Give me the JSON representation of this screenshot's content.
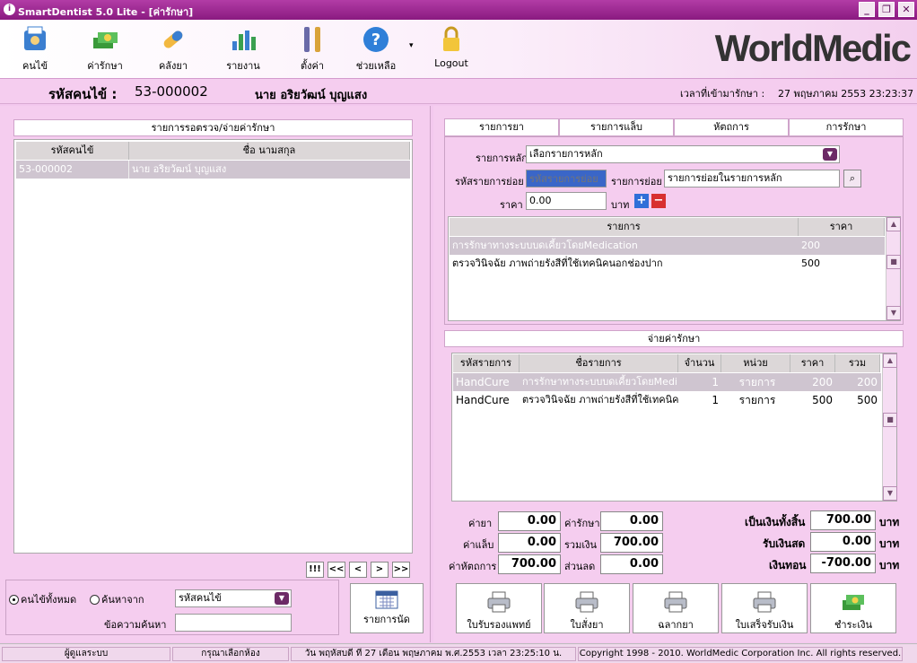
{
  "window": {
    "title": "SmartDentist 5.0 Lite - [ค่ารักษา]",
    "min": "_",
    "restore": "❐",
    "close": "✕"
  },
  "toolbar": {
    "items": [
      {
        "label": "คนไข้",
        "icon": "patient-icon"
      },
      {
        "label": "ค่ารักษา",
        "icon": "money-icon"
      },
      {
        "label": "คลังยา",
        "icon": "pill-icon"
      },
      {
        "label": "รายงาน",
        "icon": "chart-icon"
      },
      {
        "label": "ตั้งค่า",
        "icon": "tools-icon"
      },
      {
        "label": "ช่วยเหลือ",
        "icon": "help-icon"
      },
      {
        "label": "Logout",
        "icon": "lock-icon"
      }
    ],
    "brand": "WorldMedic"
  },
  "patient": {
    "id_label": "รหัสคนไข้ :",
    "id": "53-000002",
    "name": "นาย อริยวัฒน์ บุญแสง",
    "time_label": "เวลาที่เข้ามารักษา :",
    "time": "27 พฤษภาคม 2553  23:23:37"
  },
  "queue": {
    "title": "รายการรอตรวจ/จ่ายค่ารักษา",
    "headers": [
      "รหัสคนไข้",
      "ชื่อ นามสกุล"
    ],
    "rows": [
      {
        "id": "53-000002",
        "name": "นาย อริยวัฒน์ บุญแสง"
      }
    ],
    "nav": [
      "!!!",
      "<<",
      "<",
      ">",
      ">>"
    ]
  },
  "search": {
    "all_label": "คนไข้ทั้งหมด",
    "from_label": "ค้นหาจาก",
    "field": "รหัสคนไข้",
    "text_label": "ข้อความค้นหา",
    "text_value": "",
    "appt_button": "รายการนัด"
  },
  "tabs": [
    "รายการยา",
    "รายการแล็บ",
    "หัตถการ",
    "การรักษา"
  ],
  "treatment": {
    "main_label": "รายการหลัก",
    "main_value": "เลือกรายการหลัก",
    "subcode_label": "รหัสรายการย่อย",
    "subcode_placeholder": "รหัสรายการย่อย",
    "sub_label": "รายการย่อย",
    "sub_value": "รายการย่อยในรายการหลัก",
    "price_label": "ราคา",
    "price_value": "0.00",
    "unit": "บาท",
    "headers": [
      "รายการ",
      "ราคา"
    ],
    "rows": [
      {
        "name": "การรักษาทางระบบบดเคี้ยวโดยMedication",
        "price": "200"
      },
      {
        "name": "ตรวจวินิจฉัย ภาพถ่ายรังสีที่ใช้เทคนิคนอกช่องปาก",
        "price": "500"
      }
    ]
  },
  "billing": {
    "title": "จ่ายค่ารักษา",
    "headers": [
      "รหัสรายการ",
      "ชื่อรายการ",
      "จำนวน",
      "หน่วย",
      "ราคา",
      "รวม"
    ],
    "rows": [
      {
        "code": "HandCure",
        "name": "การรักษาทางระบบบดเคี้ยวโดยMedi",
        "qty": "1",
        "unit": "รายการ",
        "price": "200",
        "total": "200"
      },
      {
        "code": "HandCure",
        "name": "ตรวจวินิจฉัย ภาพถ่ายรังสีที่ใช้เทคนิค",
        "qty": "1",
        "unit": "รายการ",
        "price": "500",
        "total": "500"
      }
    ]
  },
  "totals": {
    "drug_label": "ค่ายา",
    "drug": "0.00",
    "lab_label": "ค่าแล็บ",
    "lab": "0.00",
    "proc_label": "ค่าหัตถการ",
    "proc": "700.00",
    "treat_label": "ค่ารักษา",
    "treat": "0.00",
    "sum_label": "รวมเงิน",
    "sum": "700.00",
    "disc_label": "ส่วนลด",
    "disc": "0.00",
    "grand_label": "เป็นเงินทั้งสิ้น",
    "grand": "700.00",
    "cash_label": "รับเงินสด",
    "cash": "0.00",
    "change_label": "เงินทอน",
    "change": "-700.00",
    "baht": "บาท"
  },
  "actions": [
    "ใบรับรองแพทย์",
    "ใบสั่งยา",
    "ฉลากยา",
    "ใบเสร็จรับเงิน",
    "ชำระเงิน"
  ],
  "status": {
    "user": "ผู้ดูแลระบบ",
    "room": "กรุณาเลือกห้อง",
    "date": "วัน พฤหัสบดี ที่ 27 เดือน พฤษภาคม พ.ศ.2553 เวลา 23:25:10 น.",
    "copyright": "Copyright 1998 - 2010. WorldMedic Corporation Inc. All rights reserved."
  },
  "colors": {
    "accent": "#8a1a80",
    "panel": "#f5cdef",
    "selected": "#cfc5d0"
  }
}
